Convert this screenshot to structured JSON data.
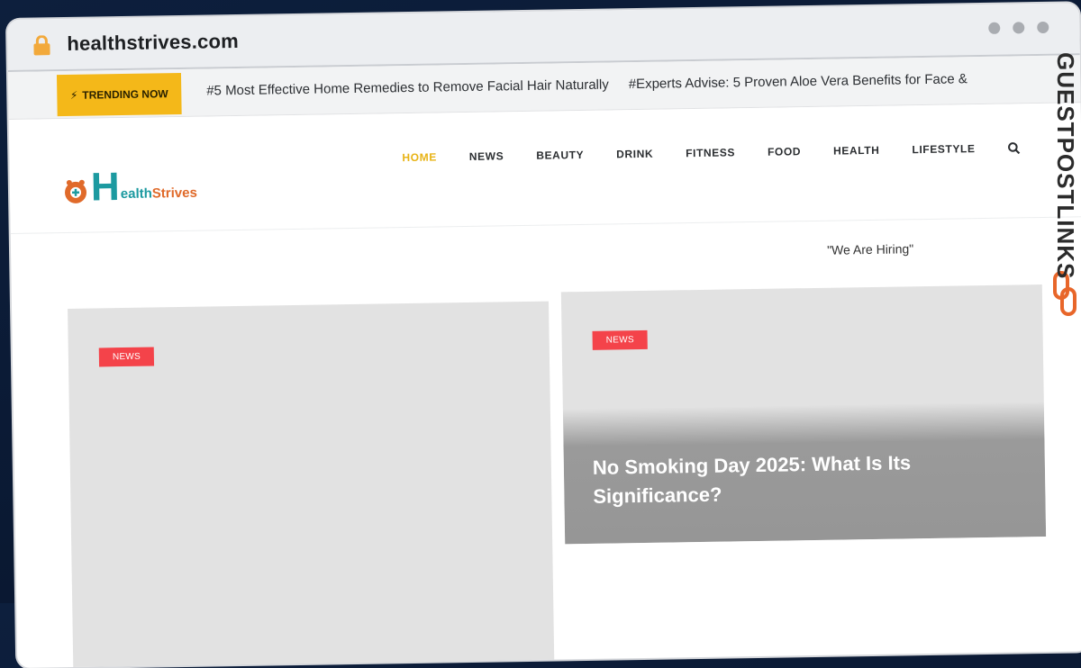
{
  "browser": {
    "url": "healthstrives.com",
    "icons": {
      "lock": "lock-icon",
      "window_dots": "window-dots-icon"
    }
  },
  "ticker": {
    "trending_label": "TRENDING NOW",
    "items": [
      "#5 Most Effective Home Remedies to Remove Facial Hair Naturally",
      "#Experts Advise: 5 Proven Aloe Vera Benefits for Face &"
    ]
  },
  "site": {
    "logo_letter": "H",
    "logo_rest_1": "ealth",
    "logo_rest_2": "Strives",
    "nav": [
      "HOME",
      "NEWS",
      "BEAUTY",
      "DRINK",
      "FITNESS",
      "FOOD",
      "HEALTH",
      "LIFESTYLE"
    ],
    "active_nav": "HOME",
    "hiring_text": "\"We Are Hiring\""
  },
  "cards": [
    {
      "badge": "NEWS",
      "title": ""
    },
    {
      "badge": "NEWS",
      "title": "No Smoking Day 2025: What Is Its Significance?"
    }
  ],
  "watermark": {
    "text": "GUESTPOSTLINKS"
  },
  "colors": {
    "trending_bg": "#f4b819",
    "active_nav": "#e8b315",
    "badge": "#f4434a",
    "brand_teal": "#1c9aa0",
    "watermark_orange": "#e8662a"
  }
}
